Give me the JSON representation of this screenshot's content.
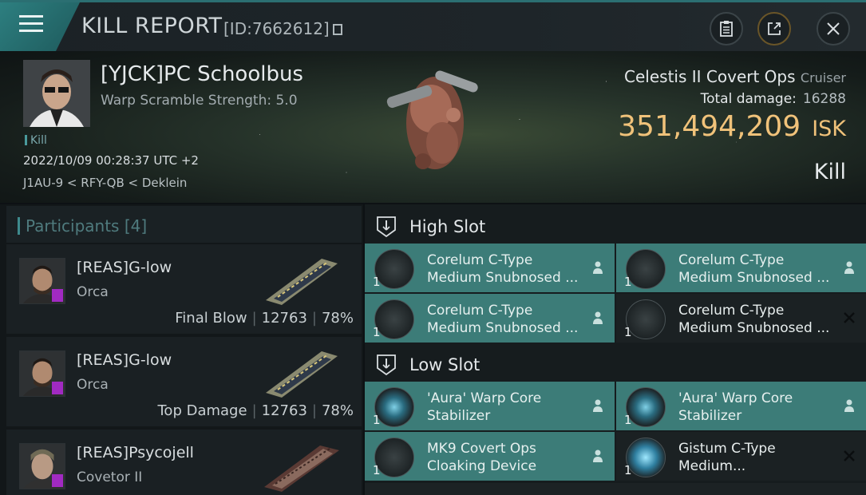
{
  "header": {
    "title": "KILL REPORT",
    "kill_id": "[ID:7662612]",
    "icons": [
      "menu-icon",
      "clipboard-icon",
      "external-link-icon",
      "close-icon"
    ]
  },
  "victim": {
    "name": "[YJCK]PC Schoolbus",
    "warp_scramble": "Warp Scramble Strength: 5.0",
    "tag": "Kill",
    "datetime": "2022/10/09 00:28:37 UTC +2",
    "location": "J1AU-9 < RFY-QB < Deklein",
    "ship_name": "Celestis II Covert Ops",
    "ship_class": "Cruiser",
    "total_damage_label": "Total damage:",
    "total_damage": "16288",
    "isk_value": "351,494,209",
    "isk_unit": "ISK",
    "result": "Kill"
  },
  "participants": {
    "title": "Participants [4]",
    "rows": [
      {
        "name": "[REAS]G-low",
        "ship": "Orca",
        "role": "Final Blow",
        "damage": "12763",
        "percent": "78%"
      },
      {
        "name": "[REAS]G-low",
        "ship": "Orca",
        "role": "Top Damage",
        "damage": "12763",
        "percent": "78%"
      },
      {
        "name": "[REAS]Psycojell",
        "ship": "Covetor II",
        "role": "",
        "damage": "",
        "percent": ""
      }
    ]
  },
  "fittings": {
    "high_slot_label": "High Slot",
    "low_slot_label": "Low Slot",
    "high": [
      {
        "qty": "1",
        "name": "Corelum C-Type Medium Snubnosed ...",
        "state": "dropped"
      },
      {
        "qty": "1",
        "name": "Corelum C-Type Medium Snubnosed ...",
        "state": "dropped"
      },
      {
        "qty": "1",
        "name": "Corelum C-Type Medium Snubnosed ...",
        "state": "dropped"
      },
      {
        "qty": "1",
        "name": "Corelum C-Type Medium Snubnosed ...",
        "state": "destroyed"
      }
    ],
    "low": [
      {
        "qty": "1",
        "name": "'Aura' Warp Core Stabilizer",
        "state": "dropped"
      },
      {
        "qty": "1",
        "name": "'Aura' Warp Core Stabilizer",
        "state": "dropped"
      },
      {
        "qty": "1",
        "name": "MK9 Covert Ops Cloaking Device",
        "state": "dropped"
      },
      {
        "qty": "1",
        "name": "Gistum C-Type Medium...",
        "state": "destroyed"
      }
    ]
  },
  "colors": {
    "accent": "#2d7f80",
    "dropped_bg": "#3c7c78",
    "isk": "#f0c27a",
    "corp_badge": "#a12ac2"
  }
}
